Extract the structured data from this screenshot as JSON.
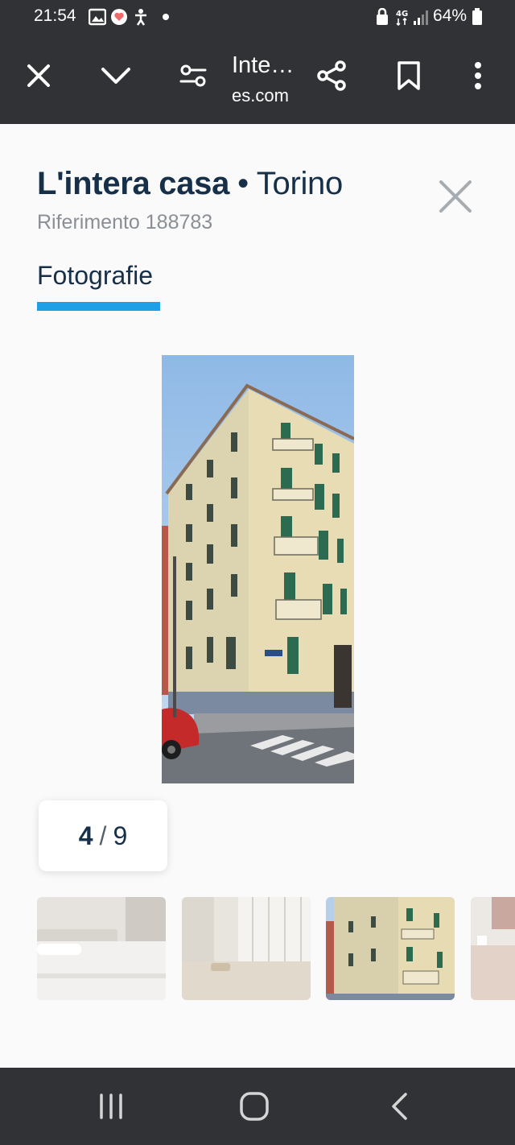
{
  "status_bar": {
    "time": "21:54",
    "battery": "64%",
    "icons": [
      "gallery-icon",
      "app-notification-icon",
      "accessibility-icon",
      "dot-icon",
      "lock-icon",
      "network-4g-icon",
      "signal-icon",
      "battery-icon"
    ]
  },
  "browser": {
    "title": "Inte…",
    "url": "es.com",
    "icons": [
      "close-icon",
      "chevron-down-icon",
      "settings-sliders-icon",
      "share-icon",
      "bookmark-icon",
      "more-vert-icon"
    ]
  },
  "listing": {
    "title_bold": "L'intera casa",
    "separator": "•",
    "city": "Torino",
    "reference": "Riferimento 188783"
  },
  "tabs": {
    "photos": "Fotografie"
  },
  "gallery": {
    "current": "4",
    "separator": "/",
    "total": "9"
  },
  "colors": {
    "bar_bg": "#303236",
    "text_dark": "#16304a",
    "accent": "#1ea0e6",
    "page_bg": "#fafafa"
  },
  "navbar": {
    "icons": [
      "recent-apps-icon",
      "home-icon",
      "back-icon"
    ]
  }
}
